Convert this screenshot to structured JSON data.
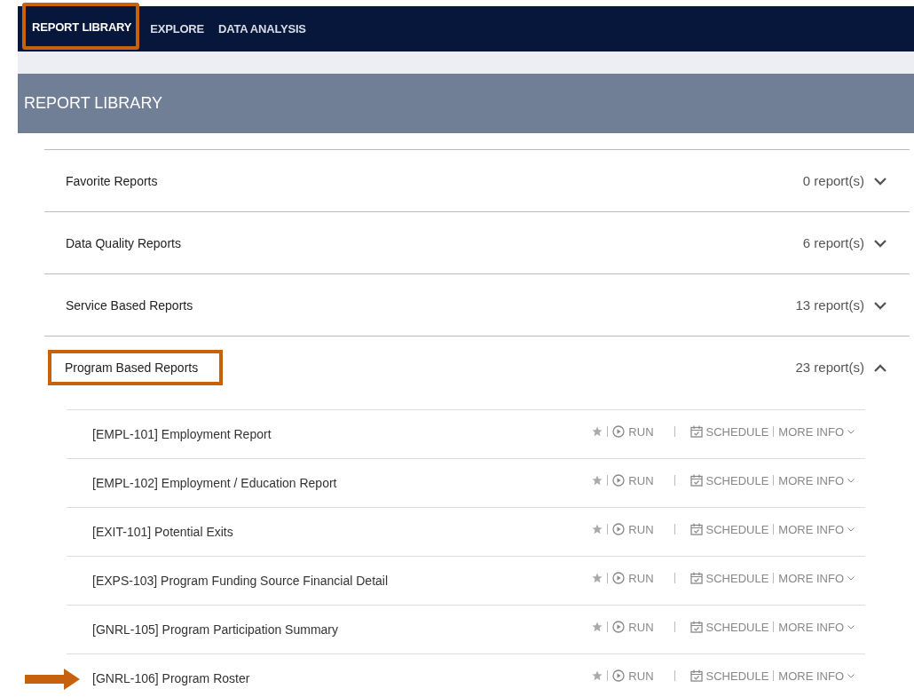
{
  "nav": {
    "tabs": [
      {
        "label": "REPORT LIBRARY",
        "selected": true,
        "highlighted": true
      },
      {
        "label": "EXPLORE",
        "selected": false,
        "highlighted": false
      },
      {
        "label": "DATA ANALYSIS",
        "selected": false,
        "highlighted": false
      }
    ]
  },
  "header": {
    "title": "REPORT LIBRARY"
  },
  "sections": [
    {
      "title": "Favorite Reports",
      "count": "0 report(s)",
      "expanded": false,
      "highlighted": false
    },
    {
      "title": "Data Quality Reports",
      "count": "6 report(s)",
      "expanded": false,
      "highlighted": false
    },
    {
      "title": "Service Based Reports",
      "count": "13 report(s)",
      "expanded": false,
      "highlighted": false
    },
    {
      "title": "Program Based Reports",
      "count": "23 report(s)",
      "expanded": true,
      "highlighted": true,
      "reports": [
        {
          "name": "[EMPL-101] Employment Report",
          "run": "RUN",
          "schedule": "SCHEDULE",
          "more": "MORE INFO",
          "pointed": false
        },
        {
          "name": "[EMPL-102] Employment / Education Report",
          "run": "RUN",
          "schedule": "SCHEDULE",
          "more": "MORE INFO",
          "pointed": false
        },
        {
          "name": "[EXIT-101] Potential Exits",
          "run": "RUN",
          "schedule": "SCHEDULE",
          "more": "MORE INFO",
          "pointed": false
        },
        {
          "name": "[EXPS-103] Program Funding Source Financial Detail",
          "run": "RUN",
          "schedule": "SCHEDULE",
          "more": "MORE INFO",
          "pointed": false
        },
        {
          "name": "[GNRL-105] Program Participation Summary",
          "run": "RUN",
          "schedule": "SCHEDULE",
          "more": "MORE INFO",
          "pointed": false
        },
        {
          "name": "[GNRL-106] Program Roster",
          "run": "RUN",
          "schedule": "SCHEDULE",
          "more": "MORE INFO",
          "pointed": true
        }
      ]
    }
  ]
}
